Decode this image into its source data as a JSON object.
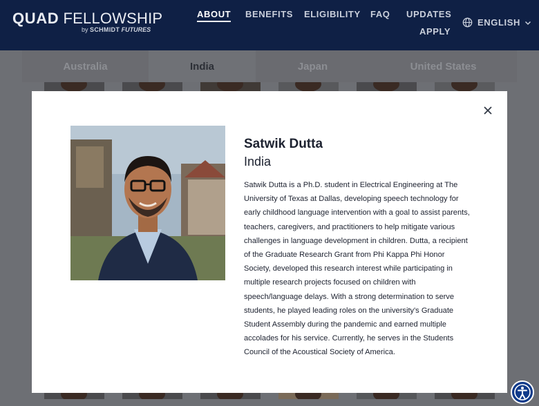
{
  "logo": {
    "quad": "QUAD",
    "fellowship": "FELLOWSHIP",
    "by": "by",
    "schmidt": "SCHMIDT",
    "futures": "FUTURES"
  },
  "nav": {
    "about": "ABOUT",
    "benefits": "BENEFITS",
    "eligibility": "ELIGIBILITY",
    "faq": "FAQ",
    "updates": "UPDATES",
    "apply": "APPLY"
  },
  "language": {
    "label": "ENGLISH",
    "icon": "globe-icon"
  },
  "tabs": [
    "Australia",
    "India",
    "Japan",
    "United States"
  ],
  "active_tab": "India",
  "modal": {
    "name": "Satwik Dutta",
    "country": "India",
    "bio": "Satwik Dutta is a Ph.D. student in Electrical Engineering at The University of Texas at Dallas, developing speech technology for early childhood language intervention with a goal to assist parents, teachers, caregivers, and practitioners to help mitigate various challenges in language development in children. Dutta, a recipient of the Graduate Research Grant from Phi Kappa Phi Honor Society, developed this research interest while participating in multiple research projects focused on children with speech/language delays. With a strong determination to serve students, he played leading roles on the university's Graduate Student Assembly during the pandemic and earned multiple accolades for his service. Currently, he serves in the Students Council of the Acoustical Society of America.",
    "close_icon": "close-icon"
  },
  "colors": {
    "header": "#0f2045",
    "overlay": "#6d6f74",
    "text": "#1d2230"
  }
}
